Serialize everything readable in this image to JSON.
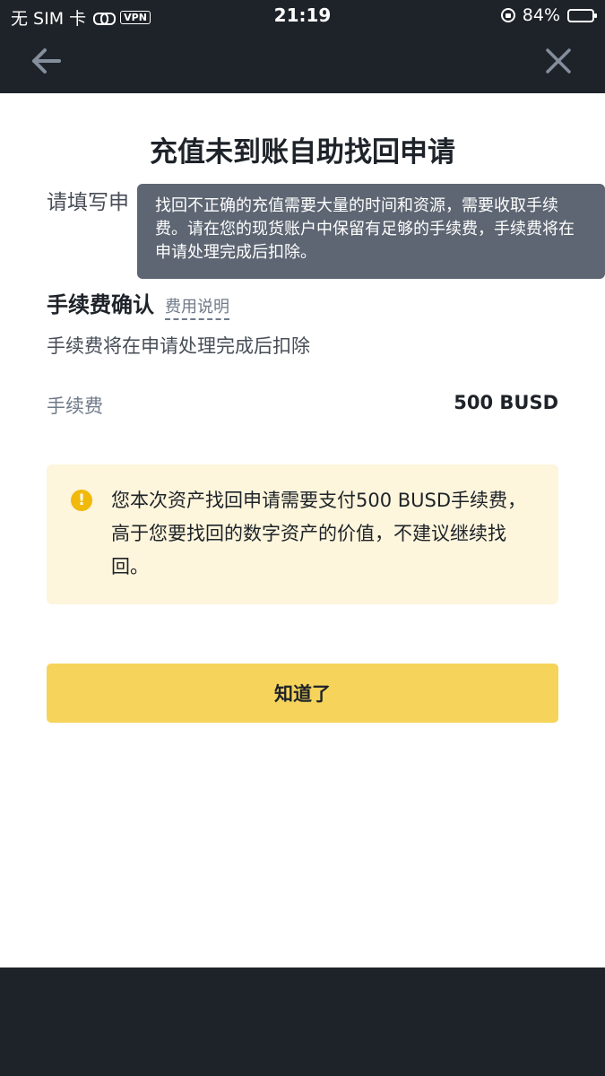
{
  "status_bar": {
    "carrier": "无 SIM 卡",
    "vpn": "VPN",
    "time": "21:19",
    "battery_text": "84%",
    "battery_level": 0.84
  },
  "nav": {
    "back_icon": "arrow-left-icon",
    "close_icon": "close-icon"
  },
  "page": {
    "title": "充值未到账自助找回申请",
    "subheading_partial": "请填写申",
    "tooltip": "找回不正确的充值需要大量的时间和资源，需要收取手续费。请在您的现货账户中保留有足够的手续费，手续费将在申请处理完成后扣除。",
    "fee_title": "手续费确认",
    "fee_link": "费用说明",
    "fee_desc": "手续费将在申请处理完成后扣除",
    "fee_label": "手续费",
    "fee_value": "500 BUSD",
    "warning_icon": "exclamation-icon",
    "warning_text": "您本次资产找回申请需要支付500 BUSD手续费，高于您要找回的数字资产的价值，不建议继续找回。",
    "button_label": "知道了"
  },
  "colors": {
    "dark_bg": "#1e2329",
    "tooltip_bg": "#5e6673",
    "warning_bg": "#fdf5dc",
    "warning_icon": "#f0b90b",
    "button_bg": "#f6d45b"
  }
}
